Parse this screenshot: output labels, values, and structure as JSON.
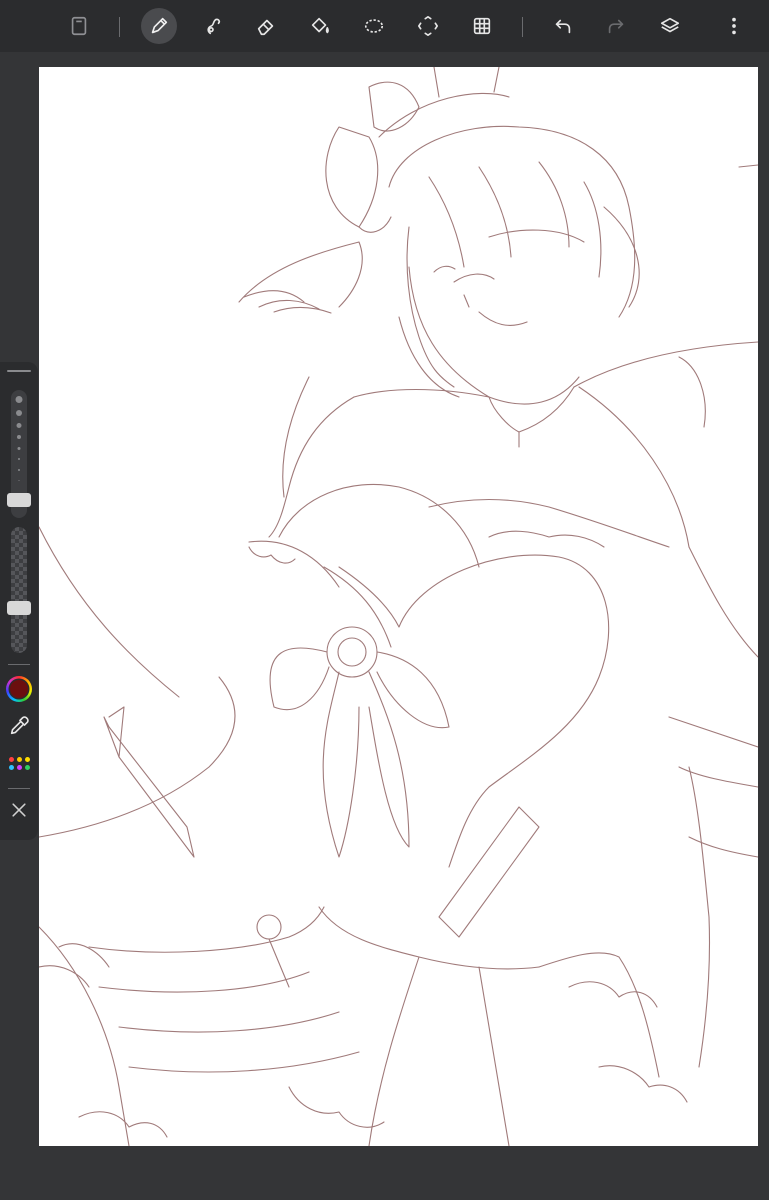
{
  "app": {
    "accent_color": "#4a4b4e",
    "icon_color": "#e6e6e6",
    "disabled_icon_color": "#6a6b6e"
  },
  "toolbar": {
    "tools": [
      {
        "name": "gallery-icon",
        "state": "normal"
      },
      {
        "name": "brush-icon",
        "state": "active"
      },
      {
        "name": "smudge-icon",
        "state": "normal"
      },
      {
        "name": "eraser-icon",
        "state": "normal"
      },
      {
        "name": "fill-bucket-icon",
        "state": "normal"
      },
      {
        "name": "lasso-select-icon",
        "state": "normal"
      },
      {
        "name": "transform-icon",
        "state": "normal"
      },
      {
        "name": "grid-icon",
        "state": "normal"
      },
      {
        "name": "undo-icon",
        "state": "normal"
      },
      {
        "name": "redo-icon",
        "state": "disabled"
      },
      {
        "name": "layers-icon",
        "state": "normal"
      },
      {
        "name": "more-vertical-icon",
        "state": "normal"
      }
    ]
  },
  "sidebar": {
    "brush_size_level": 0.88,
    "brush_opacity_level": 0.36,
    "current_color": "#6b0f0f",
    "palette_colors": [
      "#ff4040",
      "#ffcc00",
      "#ffdd00",
      "#30c0ff",
      "#d040ff",
      "#30d060"
    ],
    "icons": [
      "color-wheel-icon",
      "eyedropper-icon",
      "palette-icon",
      "close-icon"
    ]
  },
  "canvas": {
    "background": "#ffffff",
    "stroke_color": "#a07a7a",
    "content": "sketch"
  }
}
